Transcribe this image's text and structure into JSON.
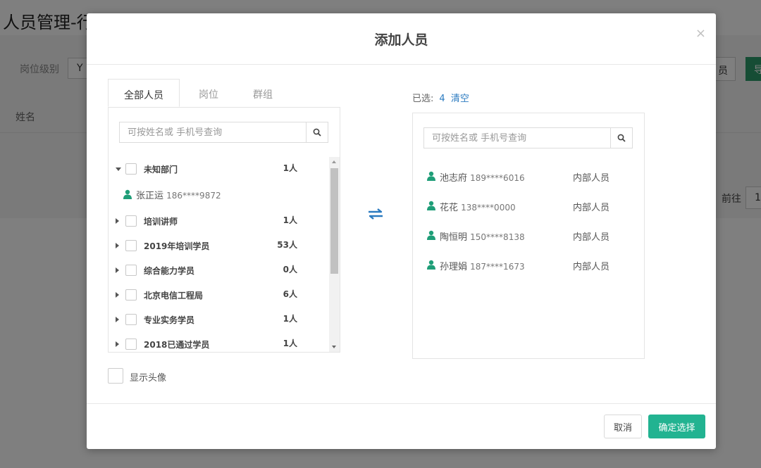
{
  "background": {
    "page_title": "人员管理-行政",
    "filter_label": "岗位级别",
    "filter_value": "Y",
    "column_name": "姓名",
    "button_partial": "员",
    "button_green_partial": "导",
    "goto_label": "前往",
    "goto_value": "1"
  },
  "modal": {
    "title": "添加人员",
    "close": "×",
    "tabs": [
      {
        "label": "全部人员",
        "active": true
      },
      {
        "label": "岗位",
        "active": false
      },
      {
        "label": "群组",
        "active": false
      }
    ],
    "left_search_placeholder": "可按姓名或 手机号查询",
    "right_search_placeholder": "可按姓名或 手机号查询",
    "tree": {
      "expanded_dept": {
        "name": "未知部门",
        "count": "1人"
      },
      "expanded_person": {
        "name": "张正运",
        "phone": "186****9872"
      },
      "depts": [
        {
          "name": "培训讲师",
          "count": "1人"
        },
        {
          "name": "2019年培训学员",
          "count": "53人"
        },
        {
          "name": "综合能力学员",
          "count": "0人"
        },
        {
          "name": "北京电信工程局",
          "count": "6人"
        },
        {
          "name": "专业实务学员",
          "count": "1人"
        },
        {
          "name": "2018已通过学员",
          "count": "1人"
        }
      ]
    },
    "show_avatar_label": "显示头像",
    "selected_label": "已选:",
    "selected_count": "4",
    "clear_label": "清空",
    "selected": [
      {
        "name": "池志府",
        "phone": "189****6016",
        "type": "内部人员"
      },
      {
        "name": "花花",
        "phone": "138****0000",
        "type": "内部人员"
      },
      {
        "name": "陶恒明",
        "phone": "150****8138",
        "type": "内部人员"
      },
      {
        "name": "孙理娟",
        "phone": "187****1673",
        "type": "内部人员"
      }
    ],
    "cancel_label": "取消",
    "confirm_label": "确定选择"
  },
  "colors": {
    "accent_green": "#22b391",
    "link_blue": "#2b7bc0",
    "person_icon": "#1f9e78",
    "overlay": "rgba(0,0,0,0.5)"
  }
}
